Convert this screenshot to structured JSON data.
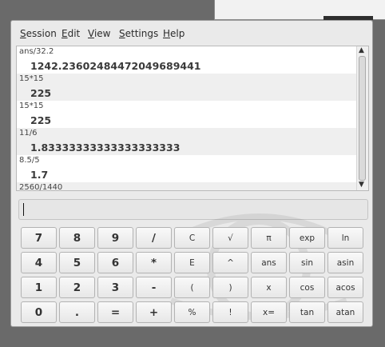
{
  "menu": [
    {
      "label": "Session",
      "mnemonic": "S",
      "rest": "ession"
    },
    {
      "label": "Edit",
      "mnemonic": "E",
      "rest": "dit"
    },
    {
      "label": "View",
      "mnemonic": "V",
      "rest": "iew"
    },
    {
      "label": "Settings",
      "mnemonic": "S",
      "rest": "ettings"
    },
    {
      "label": "Help",
      "mnemonic": "H",
      "rest": "elp"
    }
  ],
  "history": [
    {
      "expr": "ans/32.2",
      "result": "1242.23602484472049689441"
    },
    {
      "expr": "15*15",
      "result": "225"
    },
    {
      "expr": "15*15",
      "result": "225"
    },
    {
      "expr": "11/6",
      "result": "1.83333333333333333333"
    },
    {
      "expr": "8.5/5",
      "result": "1.7"
    },
    {
      "expr": "2560/1440",
      "result": ""
    }
  ],
  "scrollbar": {
    "up": "▲",
    "down": "▼"
  },
  "expression_input": {
    "value": ""
  },
  "keypad": {
    "rows": [
      [
        "7",
        "8",
        "9",
        "/",
        "C",
        "√",
        "π",
        "exp",
        "ln"
      ],
      [
        "4",
        "5",
        "6",
        "*",
        "E",
        "^",
        "ans",
        "sin",
        "asin"
      ],
      [
        "1",
        "2",
        "3",
        "-",
        "(",
        ")",
        "x",
        "cos",
        "acos"
      ],
      [
        "0",
        ".",
        "=",
        "+",
        "%",
        "!",
        "x=",
        "tan",
        "atan"
      ]
    ]
  }
}
